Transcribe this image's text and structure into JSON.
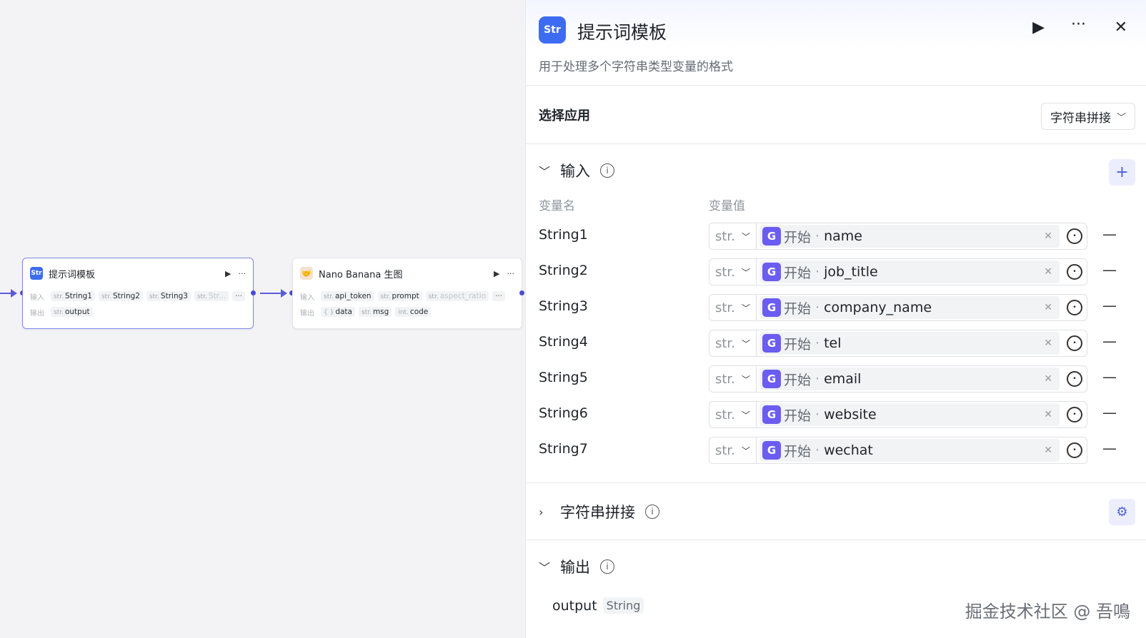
{
  "canvas": {
    "node1": {
      "title": "提示词模板",
      "icon": "Str",
      "input_label": "输入",
      "output_label": "输出",
      "inputs": [
        {
          "type": "str.",
          "name": "String1"
        },
        {
          "type": "str.",
          "name": "String2"
        },
        {
          "type": "str.",
          "name": "String3"
        },
        {
          "type": "str.",
          "name": "Str..."
        }
      ],
      "outputs": [
        {
          "type": "str.",
          "name": "output"
        }
      ],
      "more": "···"
    },
    "node2": {
      "title": "Nano Banana 生图",
      "icon": "🤝",
      "input_label": "输入",
      "output_label": "输出",
      "inputs": [
        {
          "type": "str.",
          "name": "api_token"
        },
        {
          "type": "str.",
          "name": "prompt"
        },
        {
          "type": "str.",
          "name": "aspect_ratio"
        }
      ],
      "outputs": [
        {
          "type": "{ }",
          "name": "data"
        },
        {
          "type": "str.",
          "name": "msg"
        },
        {
          "type": "int.",
          "name": "code"
        }
      ],
      "more": "···"
    }
  },
  "panel": {
    "icon": "Str",
    "title": "提示词模板",
    "description": "用于处理多个字符串类型变量的格式",
    "app_label": "选择应用",
    "app_value": "字符串拼接",
    "input_section": "输入",
    "col_name": "变量名",
    "col_value": "变量值",
    "variables": [
      {
        "name": "String1",
        "type": "str.",
        "source": "开始",
        "field": "name"
      },
      {
        "name": "String2",
        "type": "str.",
        "source": "开始",
        "field": "job_title"
      },
      {
        "name": "String3",
        "type": "str.",
        "source": "开始",
        "field": "company_name"
      },
      {
        "name": "String4",
        "type": "str.",
        "source": "开始",
        "field": "tel"
      },
      {
        "name": "String5",
        "type": "str.",
        "source": "开始",
        "field": "email"
      },
      {
        "name": "String6",
        "type": "str.",
        "source": "开始",
        "field": "website"
      },
      {
        "name": "String7",
        "type": "str.",
        "source": "开始",
        "field": "wechat"
      }
    ],
    "concat_section": "字符串拼接",
    "output_section": "输出",
    "output_name": "output",
    "output_type": "String"
  },
  "watermark": "掘金技术社区 @ 吾鳴",
  "colors": {
    "accent": "#3d6cf2",
    "edge": "#5b5bd6",
    "ref_icon": "#6b5cf2"
  }
}
